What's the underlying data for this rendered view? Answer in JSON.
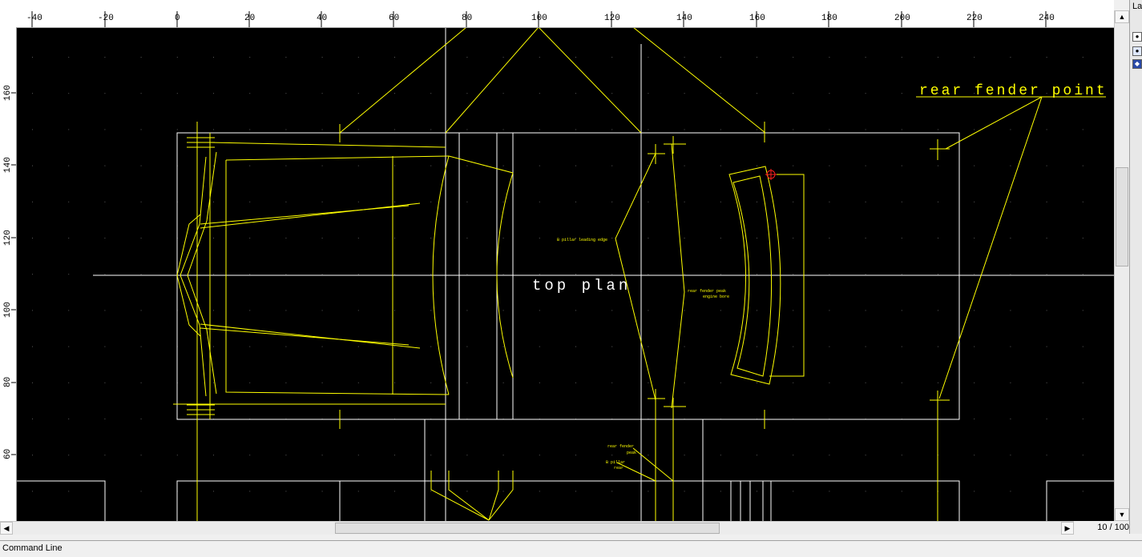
{
  "ruler": {
    "x_ticks": [
      "-40",
      "-20",
      "0",
      "20",
      "40",
      "60",
      "80",
      "100",
      "120",
      "140",
      "160",
      "180",
      "200",
      "220",
      "240"
    ],
    "y_ticks": [
      "160",
      "140",
      "120",
      "100",
      "80",
      "60"
    ]
  },
  "canvas": {
    "labels": {
      "title": "top plan",
      "callout": "rear fender point",
      "b_pillar_leading": "B pillar leading edge",
      "rear_fender_peak": "rear fender peak",
      "rear_fender_peak_2": "engine bore",
      "small_1": "rear fender",
      "small_1b": "peak",
      "small_2": "B pillar",
      "small_2b": "rear"
    },
    "colors": {
      "background": "#000000",
      "geometry": "#ffff00",
      "reference": "#ffffff",
      "marker": "#ff2020"
    }
  },
  "statusbar": {
    "page": "10 / 100"
  },
  "sidepanel": {
    "label": "La"
  },
  "command": {
    "label": "Command Line"
  },
  "icons": [
    "scroll-up-icon",
    "scroll-down-icon",
    "scroll-left-icon",
    "scroll-right-icon",
    "eye-icon",
    "layer-icon",
    "point-marker-icon"
  ]
}
